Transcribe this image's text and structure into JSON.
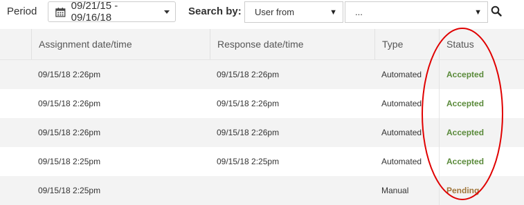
{
  "filters": {
    "period_label": "Period",
    "date_range": "09/21/15 - 09/16/18",
    "search_label": "Search by:",
    "search_field": "User from",
    "search_value": "..."
  },
  "icons": {
    "calendar": "calendar-icon",
    "search": "magnifier-icon",
    "dropdown": "caret-down-icon"
  },
  "table": {
    "headers": {
      "assignment": "Assignment date/time",
      "response": "Response date/time",
      "type": "Type",
      "status": "Status"
    },
    "rows": [
      {
        "assignment": "09/15/18 2:26pm",
        "response": "09/15/18 2:26pm",
        "type": "Automated",
        "status": "Accepted"
      },
      {
        "assignment": "09/15/18 2:26pm",
        "response": "09/15/18 2:26pm",
        "type": "Automated",
        "status": "Accepted"
      },
      {
        "assignment": "09/15/18 2:26pm",
        "response": "09/15/18 2:26pm",
        "type": "Automated",
        "status": "Accepted"
      },
      {
        "assignment": "09/15/18 2:25pm",
        "response": "09/15/18 2:25pm",
        "type": "Automated",
        "status": "Accepted"
      },
      {
        "assignment": "09/15/18 2:25pm",
        "response": "",
        "type": "Manual",
        "status": "Pending"
      }
    ]
  },
  "colors": {
    "accepted": "#5a8a3a",
    "pending": "#a0763a",
    "annotation": "#e00000",
    "header_bg": "#f3f3f3"
  }
}
